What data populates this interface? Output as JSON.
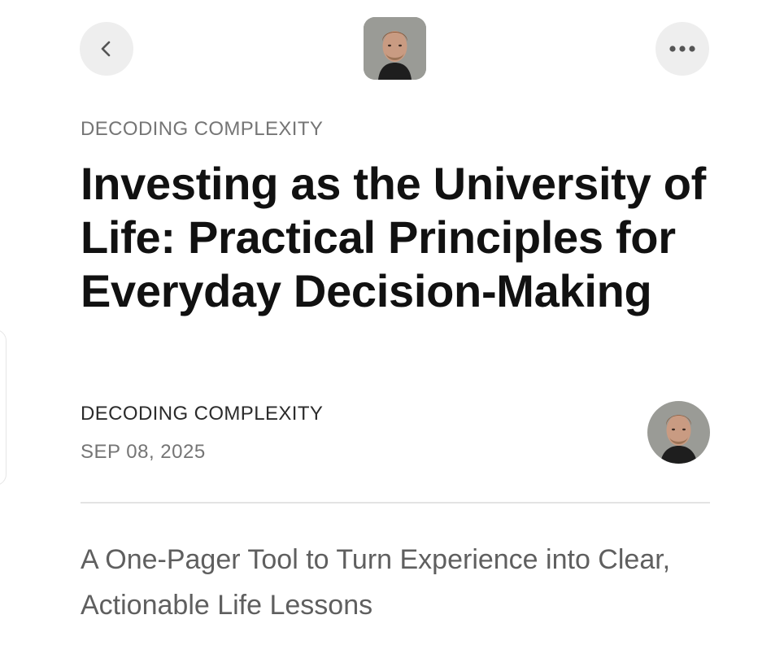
{
  "header": {
    "back_icon": "chevron-left-icon",
    "more_icon": "more-horizontal-icon",
    "publication_avatar": "author-photo"
  },
  "article": {
    "section_label": "DECODING COMPLEXITY",
    "title": "Investing as the University of Life: Practical Principles for Everyday Decision-Making",
    "author": "DECODING COMPLEXITY",
    "date": "SEP 08, 2025",
    "subtitle": "A One-Pager Tool to Turn Experience into Clear, Actionable Life Lessons"
  },
  "colors": {
    "background": "#ffffff",
    "title": "#111111",
    "muted": "#757575",
    "button_bg": "#eeeeee",
    "divider": "#e3e3e3"
  }
}
